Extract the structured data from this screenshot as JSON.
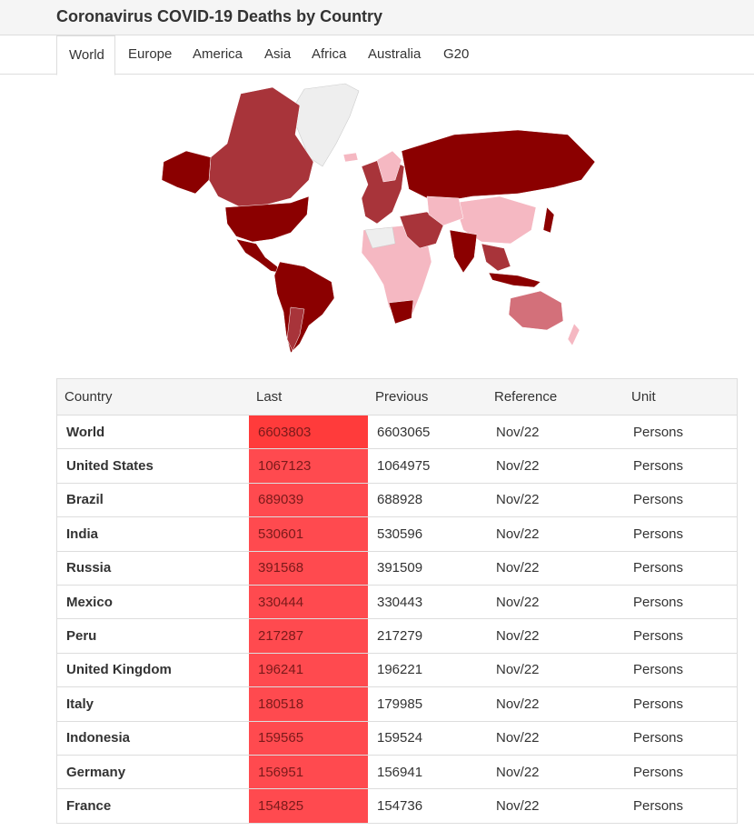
{
  "page": {
    "title": "Coronavirus COVID-19 Deaths by Country"
  },
  "tabs": [
    {
      "label": "World",
      "active": true
    },
    {
      "label": "Europe"
    },
    {
      "label": "America"
    },
    {
      "label": "Asia"
    },
    {
      "label": "Africa"
    },
    {
      "label": "Australia"
    },
    {
      "label": "G20"
    }
  ],
  "colors": {
    "world_last_bg": "#ff3b3b",
    "row_last_bg": "#ff4a4f",
    "map_dark": "#8b0000",
    "map_mid": "#a8343a",
    "map_light": "#f5b8c2",
    "map_none": "#eeeeee"
  },
  "table": {
    "headers": [
      "Country",
      "Last",
      "Previous",
      "Reference",
      "Unit"
    ],
    "rows": [
      {
        "country": "World",
        "last": "6603803",
        "previous": "6603065",
        "reference": "Nov/22",
        "unit": "Persons"
      },
      {
        "country": "United States",
        "last": "1067123",
        "previous": "1064975",
        "reference": "Nov/22",
        "unit": "Persons"
      },
      {
        "country": "Brazil",
        "last": "689039",
        "previous": "688928",
        "reference": "Nov/22",
        "unit": "Persons"
      },
      {
        "country": "India",
        "last": "530601",
        "previous": "530596",
        "reference": "Nov/22",
        "unit": "Persons"
      },
      {
        "country": "Russia",
        "last": "391568",
        "previous": "391509",
        "reference": "Nov/22",
        "unit": "Persons"
      },
      {
        "country": "Mexico",
        "last": "330444",
        "previous": "330443",
        "reference": "Nov/22",
        "unit": "Persons"
      },
      {
        "country": "Peru",
        "last": "217287",
        "previous": "217279",
        "reference": "Nov/22",
        "unit": "Persons"
      },
      {
        "country": "United Kingdom",
        "last": "196241",
        "previous": "196221",
        "reference": "Nov/22",
        "unit": "Persons"
      },
      {
        "country": "Italy",
        "last": "180518",
        "previous": "179985",
        "reference": "Nov/22",
        "unit": "Persons"
      },
      {
        "country": "Indonesia",
        "last": "159565",
        "previous": "159524",
        "reference": "Nov/22",
        "unit": "Persons"
      },
      {
        "country": "Germany",
        "last": "156951",
        "previous": "156941",
        "reference": "Nov/22",
        "unit": "Persons"
      },
      {
        "country": "France",
        "last": "154825",
        "previous": "154736",
        "reference": "Nov/22",
        "unit": "Persons"
      }
    ]
  }
}
